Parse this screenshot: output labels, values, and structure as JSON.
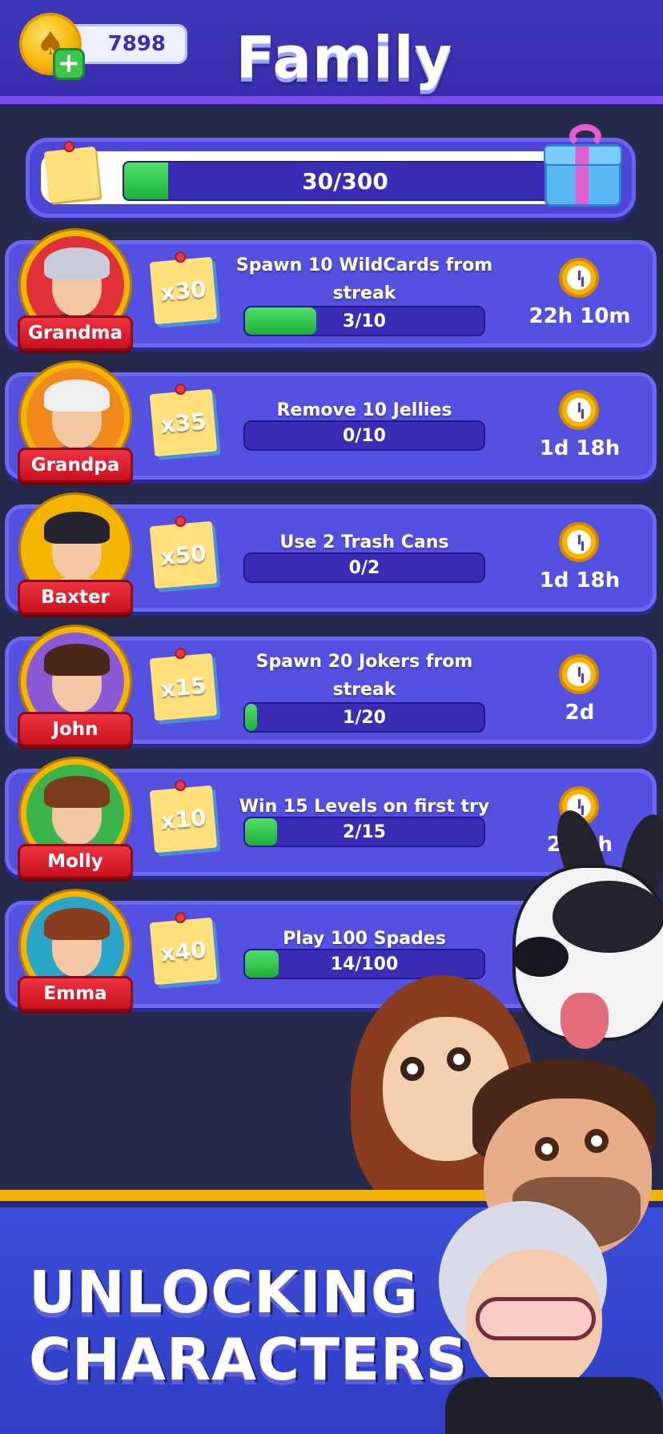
{
  "header": {
    "title": "Family",
    "coins": "7898",
    "coin_plus": "+"
  },
  "progress": {
    "label": "30/300",
    "fraction": 0.1
  },
  "tasks": [
    {
      "character": "Grandma",
      "reward": "x30",
      "title_line1": "Spawn 10 WildCards from",
      "title_line2": "streak",
      "progress": "3/10",
      "fraction": 0.3,
      "timer": "22h 10m",
      "color": "#e0303a",
      "hair": "#c9ccd6",
      "body": "#3a3a4a"
    },
    {
      "character": "Grandpa",
      "reward": "x35",
      "title_line1": "Remove 10 Jellies",
      "title_line2": "",
      "progress": "0/10",
      "fraction": 0,
      "timer": "1d 18h",
      "color": "#f08a1c",
      "hair": "#eeeeee",
      "body": "#3b7ab8"
    },
    {
      "character": "Baxter",
      "reward": "x50",
      "title_line1": "Use 2 Trash Cans",
      "title_line2": "",
      "progress": "0/2",
      "fraction": 0,
      "timer": "1d 18h",
      "color": "#f5b400",
      "hair": "#23232e",
      "body": "#f2f2f2"
    },
    {
      "character": "John",
      "reward": "x15",
      "title_line1": "Spawn 20 Jokers from",
      "title_line2": "streak",
      "progress": "1/20",
      "fraction": 0.05,
      "timer": "2d",
      "color": "#8a5ad6",
      "hair": "#4a2818",
      "body": "#5a86b8"
    },
    {
      "character": "Molly",
      "reward": "x10",
      "title_line1": "Win 15 Levels on first try",
      "title_line2": "",
      "progress": "2/15",
      "fraction": 0.133,
      "timer": "2d 6h",
      "color": "#3cb44c",
      "hair": "#7a3a1e",
      "body": "#e86f8a"
    },
    {
      "character": "Emma",
      "reward": "x40",
      "title_line1": "Play 100 Spades",
      "title_line2": "",
      "progress": "14/100",
      "fraction": 0.14,
      "timer": "",
      "color": "#2ba6c8",
      "hair": "#8a3c1e",
      "body": "#4a6a9a"
    }
  ],
  "promo": {
    "line1": "UNLOCKING",
    "line2": "CHARACTERS"
  },
  "icons": {
    "coin": "spade-coin-icon",
    "clock": "clock-icon",
    "gift": "gift-icon",
    "note": "sticky-note-icon"
  }
}
